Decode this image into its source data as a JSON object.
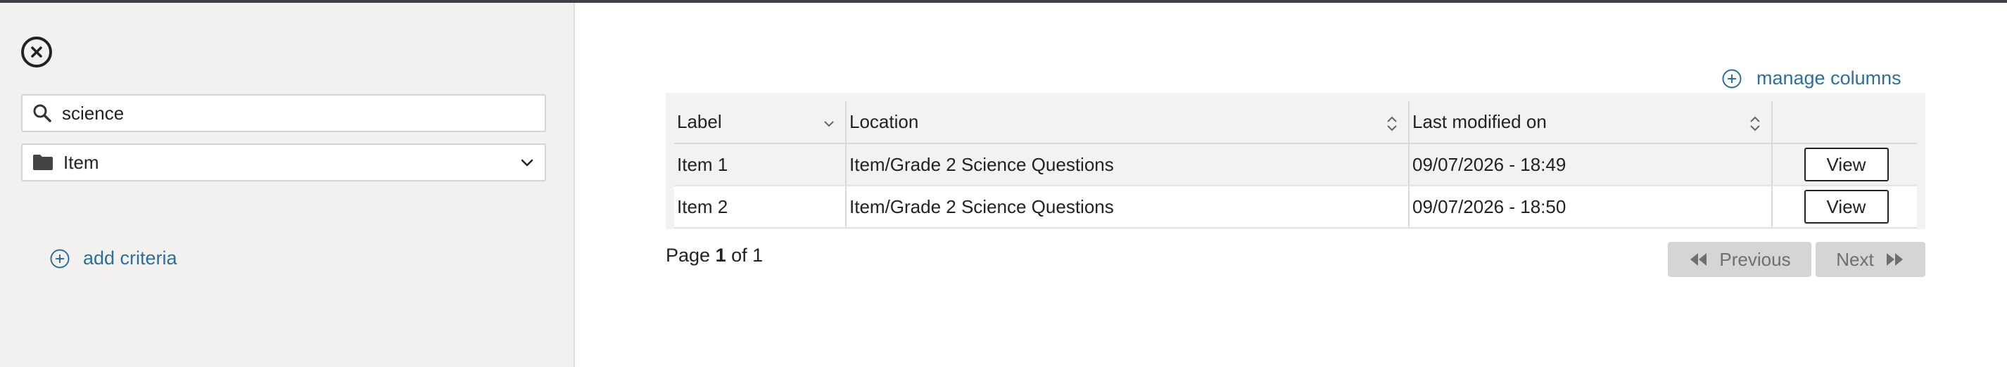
{
  "sidebar": {
    "search": {
      "value": "science",
      "placeholder": ""
    },
    "type_select": {
      "value": "Item"
    },
    "add_criteria_label": "add criteria"
  },
  "main": {
    "manage_columns_label": "manage columns",
    "table": {
      "columns": [
        "Label",
        "Location",
        "Last modified on",
        ""
      ],
      "rows": [
        {
          "label": "Item 1",
          "location": "Item/Grade 2 Science Questions",
          "modified": "09/07/2026 - 18:49",
          "action": "View"
        },
        {
          "label": "Item 2",
          "location": "Item/Grade 2 Science Questions",
          "modified": "09/07/2026 - 18:50",
          "action": "View"
        }
      ]
    },
    "pager": {
      "prefix": "Page",
      "current": "1",
      "of": "of",
      "total": "1",
      "previous_label": "Previous",
      "next_label": "Next"
    }
  },
  "colors": {
    "accent": "#2f6e96",
    "sidebar_bg": "#f2f1ef",
    "topbar": "#3c3f46"
  }
}
